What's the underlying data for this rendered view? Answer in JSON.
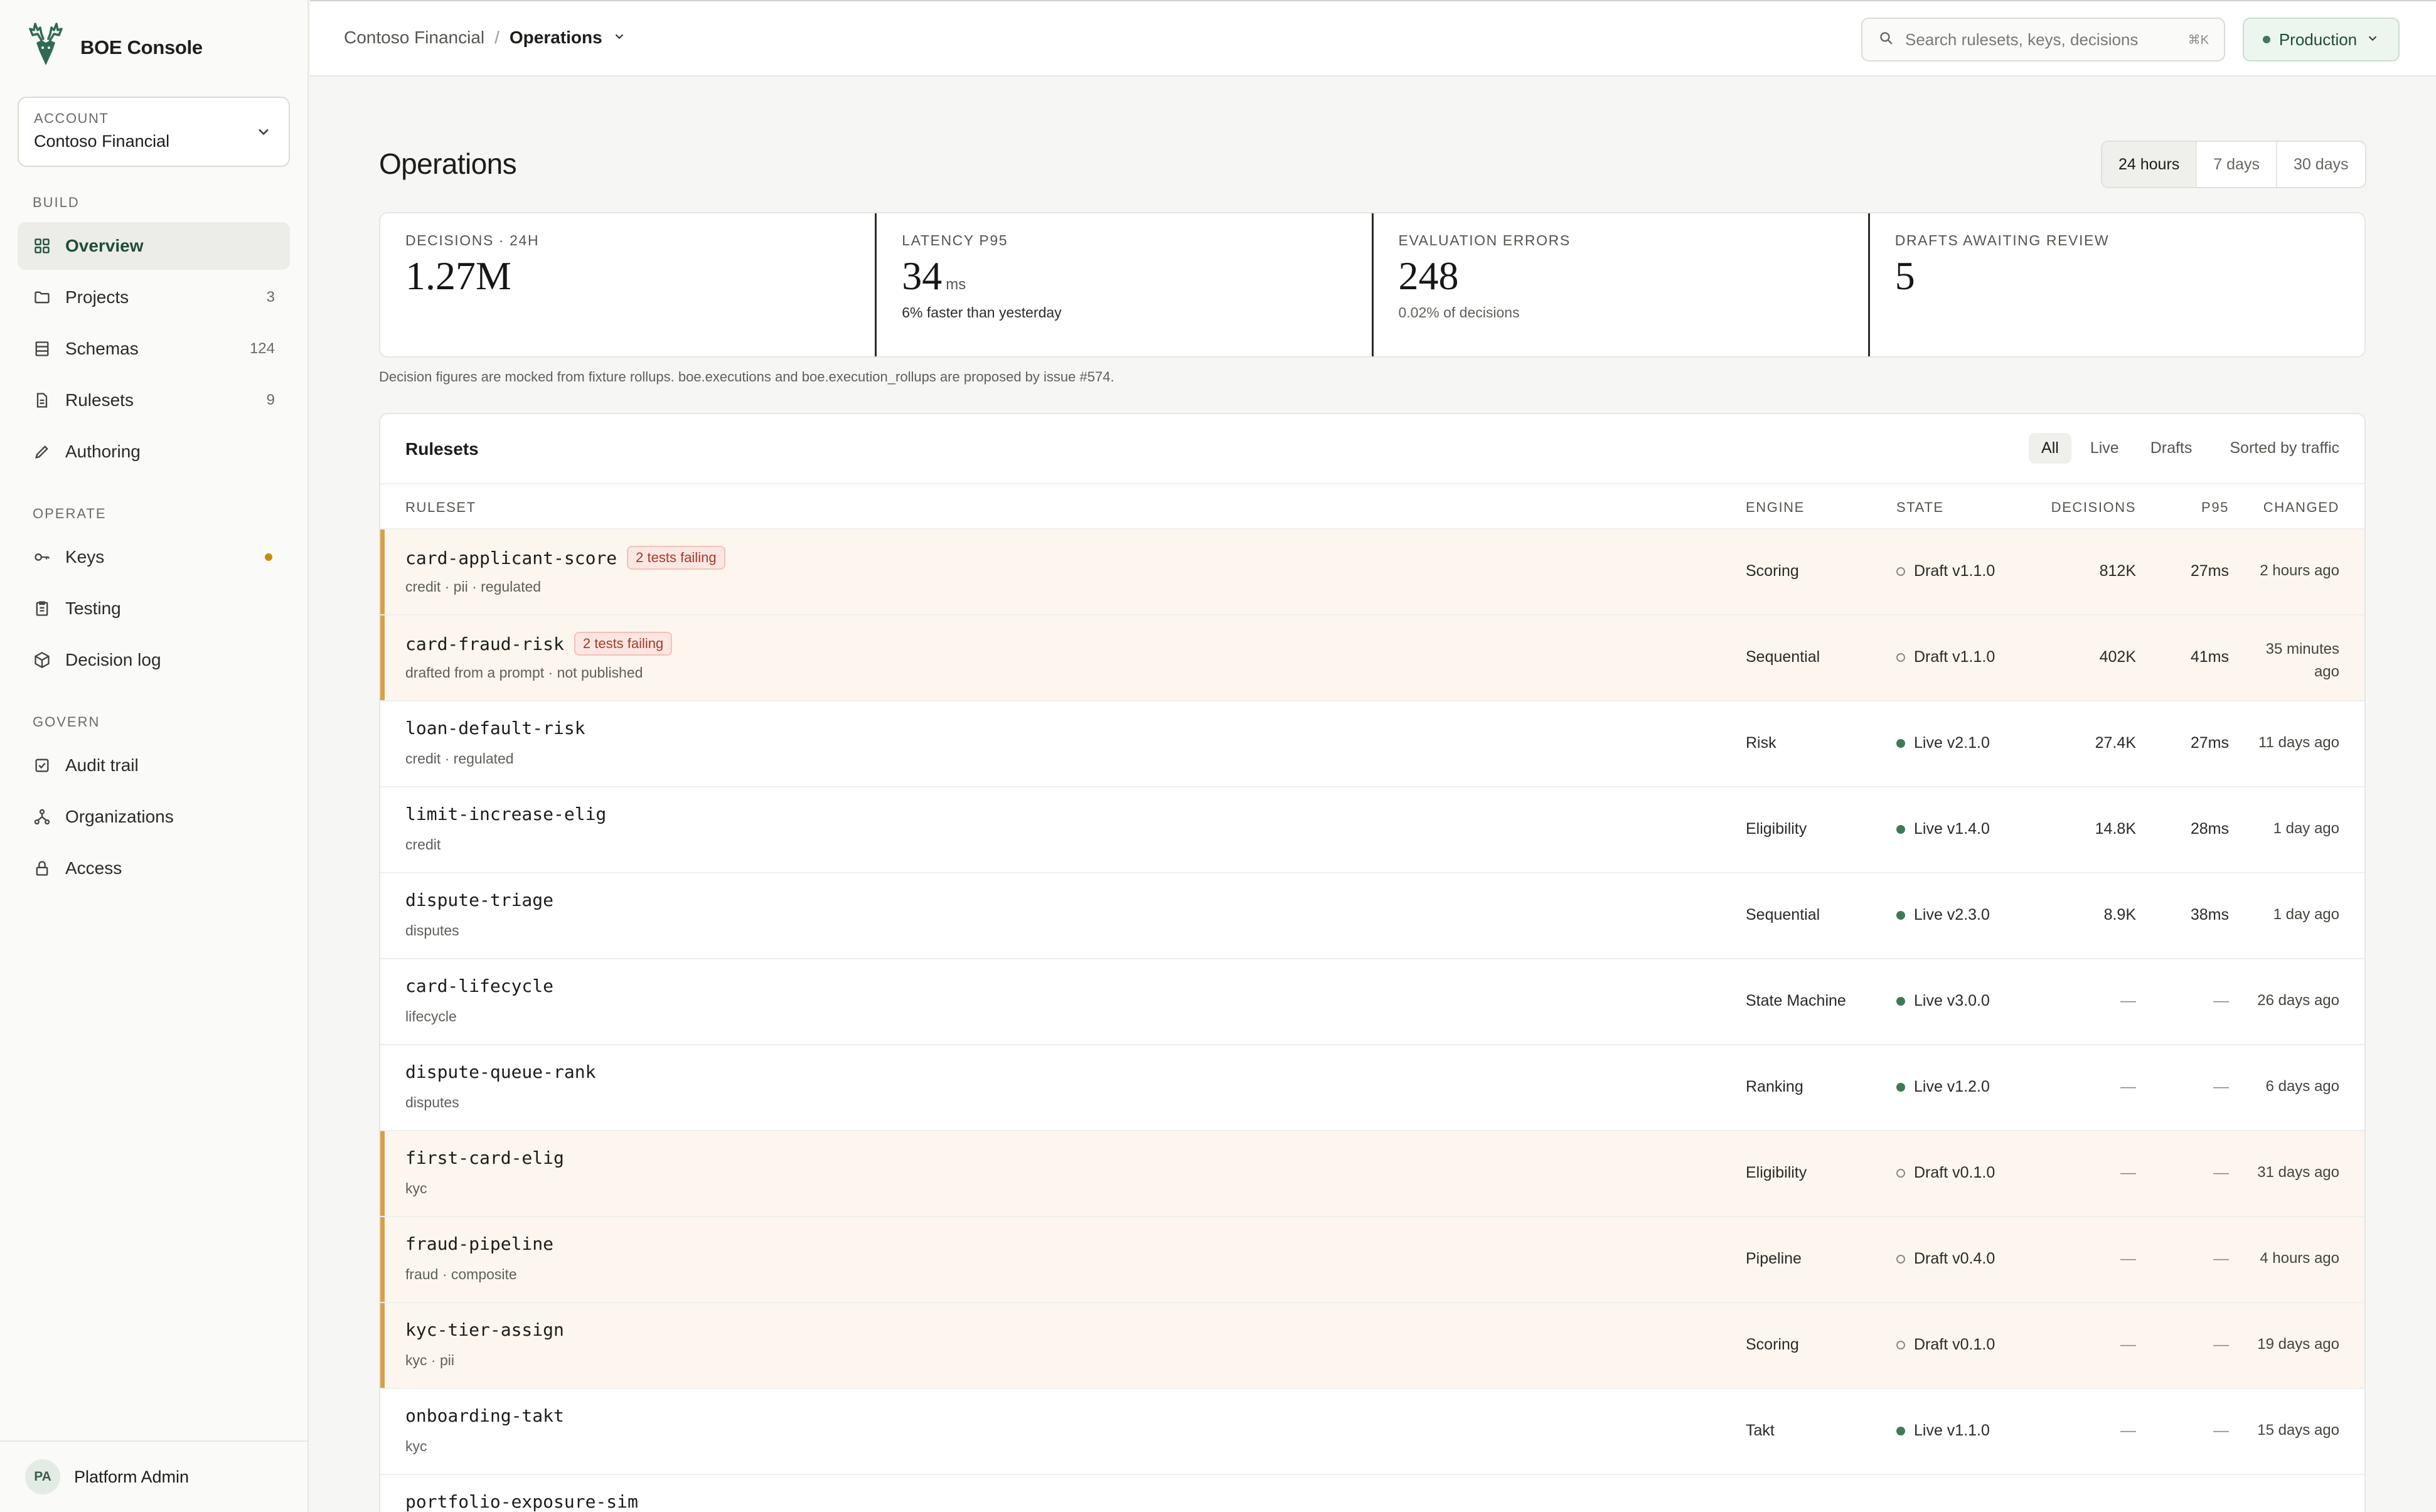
{
  "app": {
    "name": "BOE Console"
  },
  "account": {
    "label": "Account",
    "value": "Contoso Financial"
  },
  "nav": {
    "build_label": "Build",
    "operate_label": "Operate",
    "govern_label": "Govern",
    "build": [
      {
        "label": "Overview",
        "count": "",
        "icon": "grid-icon"
      },
      {
        "label": "Projects",
        "count": "3",
        "icon": "folder-icon"
      },
      {
        "label": "Schemas",
        "count": "124",
        "icon": "database-icon"
      },
      {
        "label": "Rulesets",
        "count": "9",
        "icon": "document-icon"
      },
      {
        "label": "Authoring",
        "count": "",
        "icon": "pencil-icon"
      }
    ],
    "operate": [
      {
        "label": "Keys",
        "icon": "key-icon"
      },
      {
        "label": "Testing",
        "icon": "clipboard-icon"
      },
      {
        "label": "Decision log",
        "icon": "cube-icon"
      }
    ],
    "govern": [
      {
        "label": "Audit trail",
        "icon": "checkbox-icon"
      },
      {
        "label": "Organizations",
        "icon": "org-icon"
      },
      {
        "label": "Access",
        "icon": "lock-icon"
      }
    ]
  },
  "user": {
    "initials": "PA",
    "name": "Platform Admin"
  },
  "header": {
    "breadcrumb": [
      "Contoso Financial",
      "Operations"
    ],
    "search_placeholder": "Search rulesets, keys, decisions",
    "search_shortcut": "⌘K",
    "environment": "Production"
  },
  "page": {
    "title": "Operations",
    "ranges": [
      "24 hours",
      "7 days",
      "30 days"
    ],
    "selected_range": "24 hours"
  },
  "stats": [
    {
      "label": "Decisions · 24h",
      "value": "1.27M",
      "unit": "",
      "sub": ""
    },
    {
      "label": "Latency P95",
      "value": "34",
      "unit": "ms",
      "sub": "6% faster than yesterday"
    },
    {
      "label": "Evaluation errors",
      "value": "248",
      "unit": "",
      "sub": "0.02% of decisions"
    },
    {
      "label": "Drafts awaiting review",
      "value": "5",
      "unit": "",
      "sub": ""
    }
  ],
  "note": "Decision figures are mocked from fixture rollups. boe.executions and boe.execution_rollups are proposed by issue #574.",
  "rulesets": {
    "title": "Rulesets",
    "filters": [
      "All",
      "Live",
      "Drafts"
    ],
    "selected_filter": "All",
    "sort_label": "Sorted by traffic",
    "columns": [
      "Ruleset",
      "Engine",
      "State",
      "Decisions",
      "P95",
      "Changed"
    ],
    "rows": [
      {
        "name": "card-applicant-score",
        "badge": "2 tests failing",
        "tags": "credit · pii · regulated",
        "engine": "Scoring",
        "state": "Draft v1.1.0",
        "status": "draft",
        "decisions": "812K",
        "p95": "27ms",
        "changed": "2 hours ago"
      },
      {
        "name": "card-fraud-risk",
        "badge": "2 tests failing",
        "tags": "drafted from a prompt · not published",
        "engine": "Sequential",
        "state": "Draft v1.1.0",
        "status": "draft",
        "decisions": "402K",
        "p95": "41ms",
        "changed": "35 minutes ago"
      },
      {
        "name": "loan-default-risk",
        "badge": "",
        "tags": "credit · regulated",
        "engine": "Risk",
        "state": "Live v2.1.0",
        "status": "live",
        "decisions": "27.4K",
        "p95": "27ms",
        "changed": "11 days ago"
      },
      {
        "name": "limit-increase-elig",
        "badge": "",
        "tags": "credit",
        "engine": "Eligibility",
        "state": "Live v1.4.0",
        "status": "live",
        "decisions": "14.8K",
        "p95": "28ms",
        "changed": "1 day ago"
      },
      {
        "name": "dispute-triage",
        "badge": "",
        "tags": "disputes",
        "engine": "Sequential",
        "state": "Live v2.3.0",
        "status": "live",
        "decisions": "8.9K",
        "p95": "38ms",
        "changed": "1 day ago"
      },
      {
        "name": "card-lifecycle",
        "badge": "",
        "tags": "lifecycle",
        "engine": "State Machine",
        "state": "Live v3.0.0",
        "status": "live",
        "decisions": "—",
        "p95": "—",
        "changed": "26 days ago"
      },
      {
        "name": "dispute-queue-rank",
        "badge": "",
        "tags": "disputes",
        "engine": "Ranking",
        "state": "Live v1.2.0",
        "status": "live",
        "decisions": "—",
        "p95": "—",
        "changed": "6 days ago"
      },
      {
        "name": "first-card-elig",
        "badge": "",
        "tags": "kyc",
        "engine": "Eligibility",
        "state": "Draft v0.1.0",
        "status": "draft",
        "decisions": "—",
        "p95": "—",
        "changed": "31 days ago"
      },
      {
        "name": "fraud-pipeline",
        "badge": "",
        "tags": "fraud · composite",
        "engine": "Pipeline",
        "state": "Draft v0.4.0",
        "status": "draft",
        "decisions": "—",
        "p95": "—",
        "changed": "4 hours ago"
      },
      {
        "name": "kyc-tier-assign",
        "badge": "",
        "tags": "kyc · pii",
        "engine": "Scoring",
        "state": "Draft v0.1.0",
        "status": "draft",
        "decisions": "—",
        "p95": "—",
        "changed": "19 days ago"
      },
      {
        "name": "onboarding-takt",
        "badge": "",
        "tags": "kyc",
        "engine": "Takt",
        "state": "Live v1.1.0",
        "status": "live",
        "decisions": "—",
        "p95": "—",
        "changed": "15 days ago"
      },
      {
        "name": "portfolio-exposure-sim",
        "badge": "",
        "tags": "",
        "engine": "",
        "state": "",
        "status": "",
        "decisions": "",
        "p95": "",
        "changed": ""
      }
    ]
  },
  "colors": {
    "accent": "#1f4d3a",
    "live": "#3d7a5a",
    "draft_bar": "#d7a04a",
    "warning_dot": "#c58c12",
    "failing": "#a33a2a"
  }
}
